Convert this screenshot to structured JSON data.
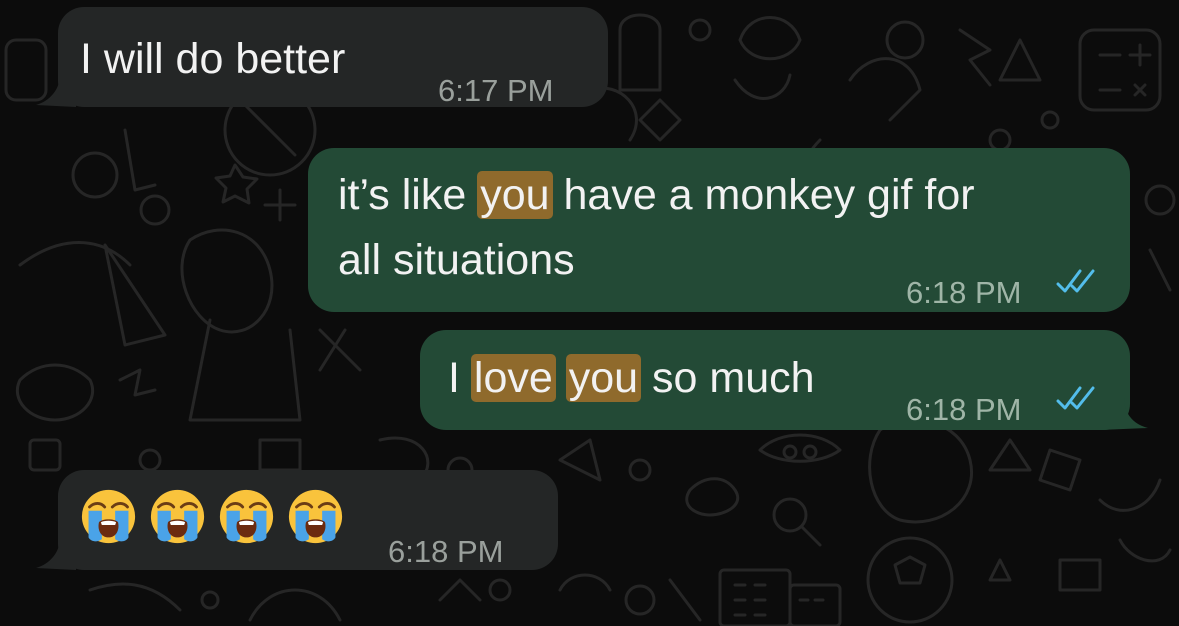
{
  "messages": [
    {
      "direction": "incoming",
      "text": "I will do better",
      "time": "6:17 PM"
    },
    {
      "direction": "outgoing",
      "line1_before": "it’s like ",
      "line1_highlight": "you",
      "line1_after": " have a monkey gif for",
      "line2": "all situations",
      "time": "6:18 PM",
      "status": "read"
    },
    {
      "direction": "outgoing",
      "before": "I ",
      "highlight1": "love",
      "middle": " ",
      "highlight2": "you",
      "after": " so much",
      "time": "6:18 PM",
      "status": "read"
    },
    {
      "direction": "incoming",
      "emojis": [
        "loudly-crying-face",
        "loudly-crying-face",
        "loudly-crying-face",
        "loudly-crying-face"
      ],
      "time": "6:18 PM"
    }
  ],
  "colors": {
    "incoming_bubble": "#242626",
    "outgoing_bubble": "#234a36",
    "search_highlight": "#8f6a2c",
    "read_ticks": "#53bdeb"
  }
}
